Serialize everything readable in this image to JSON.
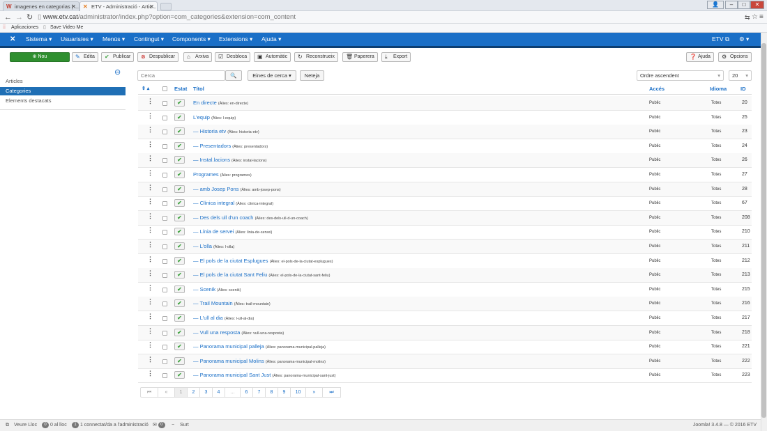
{
  "browser": {
    "tabs": [
      {
        "title": "imagenes en categorias | ...",
        "active": false
      },
      {
        "title": "ETV - Administració - Artic...",
        "active": true
      }
    ],
    "url_host": "www.etv.cat",
    "url_path": "/administrator/index.php?option=com_categories&extension=com_content",
    "bookmarks": [
      "Aplicaciones",
      "Save Video Me"
    ]
  },
  "nav": {
    "logo": "✕",
    "menus": [
      "Sistema ▾",
      "Usuaris/es ▾",
      "Menús ▾",
      "Contingut ▾",
      "Components ▾",
      "Extensions ▾",
      "Ajuda ▾"
    ],
    "site_link": "ETV ⧉",
    "user_menu": "⚙ ▾"
  },
  "toolbar": {
    "new": "Nou",
    "edit": "Edita",
    "publish": "Publicar",
    "unpublish": "Despublicar",
    "archive": "Arxiva",
    "checkin": "Desbloca",
    "batch": "Automàtic",
    "rebuild": "Reconstrueix",
    "trash": "Paperera",
    "export": "Export",
    "help": "Ajuda",
    "options": "Opcions"
  },
  "sidebar": {
    "items": [
      {
        "label": "Articles",
        "active": false
      },
      {
        "label": "Categories",
        "active": true
      },
      {
        "label": "Elements destacats",
        "active": false
      }
    ]
  },
  "filters": {
    "search_placeholder": "Cerca",
    "search_tools": "Eines de cerca ▾",
    "clear": "Neteja",
    "ordering": "Ordre ascendent",
    "limit": "20"
  },
  "table": {
    "headers": {
      "status": "Estat",
      "title": "Títol",
      "access": "Accés",
      "language": "Idioma",
      "id": "ID"
    },
    "rows": [
      {
        "title": "En directe",
        "alias": "(Àlies: en-directe)",
        "access": "Public",
        "language": "Totes",
        "id": "20"
      },
      {
        "title": "L'equip",
        "alias": "(Àlies: l-equip)",
        "access": "Public",
        "language": "Totes",
        "id": "25"
      },
      {
        "title": "— Historia etv",
        "alias": "(Àlies: historia-etv)",
        "access": "Public",
        "language": "Totes",
        "id": "23"
      },
      {
        "title": "— Presentadors",
        "alias": "(Àlies: presentadors)",
        "access": "Public",
        "language": "Totes",
        "id": "24"
      },
      {
        "title": "— Instal.lacions",
        "alias": "(Àlies: instal-lacions)",
        "access": "Public",
        "language": "Totes",
        "id": "26"
      },
      {
        "title": "Programes",
        "alias": "(Àlies: programes)",
        "access": "Public",
        "language": "Totes",
        "id": "27"
      },
      {
        "title": "— amb Josep Pons",
        "alias": "(Àlies: amb-josep-pons)",
        "access": "Public",
        "language": "Totes",
        "id": "28"
      },
      {
        "title": "— Clínica integral",
        "alias": "(Àlies: clinica-integral)",
        "access": "Public",
        "language": "Totes",
        "id": "67"
      },
      {
        "title": "— Des dels ull d'un coach",
        "alias": "(Àlies: des-dels-ull-d-un-coach)",
        "access": "Public",
        "language": "Totes",
        "id": "208"
      },
      {
        "title": "— Línia de servei",
        "alias": "(Àlies: linia-de-servei)",
        "access": "Public",
        "language": "Totes",
        "id": "210"
      },
      {
        "title": "— L'olla",
        "alias": "(Àlies: l-olla)",
        "access": "Public",
        "language": "Totes",
        "id": "211"
      },
      {
        "title": "— El pols de la ciutat Esplugues",
        "alias": "(Àlies: el-pols-de-la-ciutat-esplugues)",
        "access": "Public",
        "language": "Totes",
        "id": "212"
      },
      {
        "title": "— El pols de la ciutat Sant Feliu",
        "alias": "(Àlies: el-pols-de-la-ciutat-sant-feliu)",
        "access": "Public",
        "language": "Totes",
        "id": "213"
      },
      {
        "title": "— Scenik",
        "alias": "(Àlies: scenik)",
        "access": "Public",
        "language": "Totes",
        "id": "215"
      },
      {
        "title": "— Trail Mountain",
        "alias": "(Àlies: trail-mountain)",
        "access": "Public",
        "language": "Totes",
        "id": "216"
      },
      {
        "title": "— L'ull al dia",
        "alias": "(Àlies: l-ull-al-dia)",
        "access": "Public",
        "language": "Totes",
        "id": "217"
      },
      {
        "title": "— Vull una resposta",
        "alias": "(Àlies: vull-una-resposta)",
        "access": "Public",
        "language": "Totes",
        "id": "218"
      },
      {
        "title": "— Panorama municipal palleja",
        "alias": "(Àlies: panorama-municipal-palleja)",
        "access": "Public",
        "language": "Totes",
        "id": "221"
      },
      {
        "title": "— Panorama municipal Molins",
        "alias": "(Àlies: panorama-municipal-molins)",
        "access": "Public",
        "language": "Totes",
        "id": "222"
      },
      {
        "title": "— Panorama municipal Sant Just",
        "alias": "(Àlies: panorama-municipal-sant-just)",
        "access": "Public",
        "language": "Totes",
        "id": "223"
      }
    ]
  },
  "pagination": [
    "⏮",
    "«",
    "1",
    "2",
    "3",
    "4",
    "…",
    "6",
    "7",
    "8",
    "9",
    "10",
    "»",
    "⏭"
  ],
  "footer": {
    "view_site": "Veure Lloc",
    "visitors_count": "0",
    "visitors_label": "0 al lloc",
    "admins_count": "1",
    "admins_label": "1 connectat/da a l'administració",
    "messages_count": "0",
    "logout": "Surt",
    "version": "Joomla! 3.4.8 — © 2016 ETV"
  }
}
